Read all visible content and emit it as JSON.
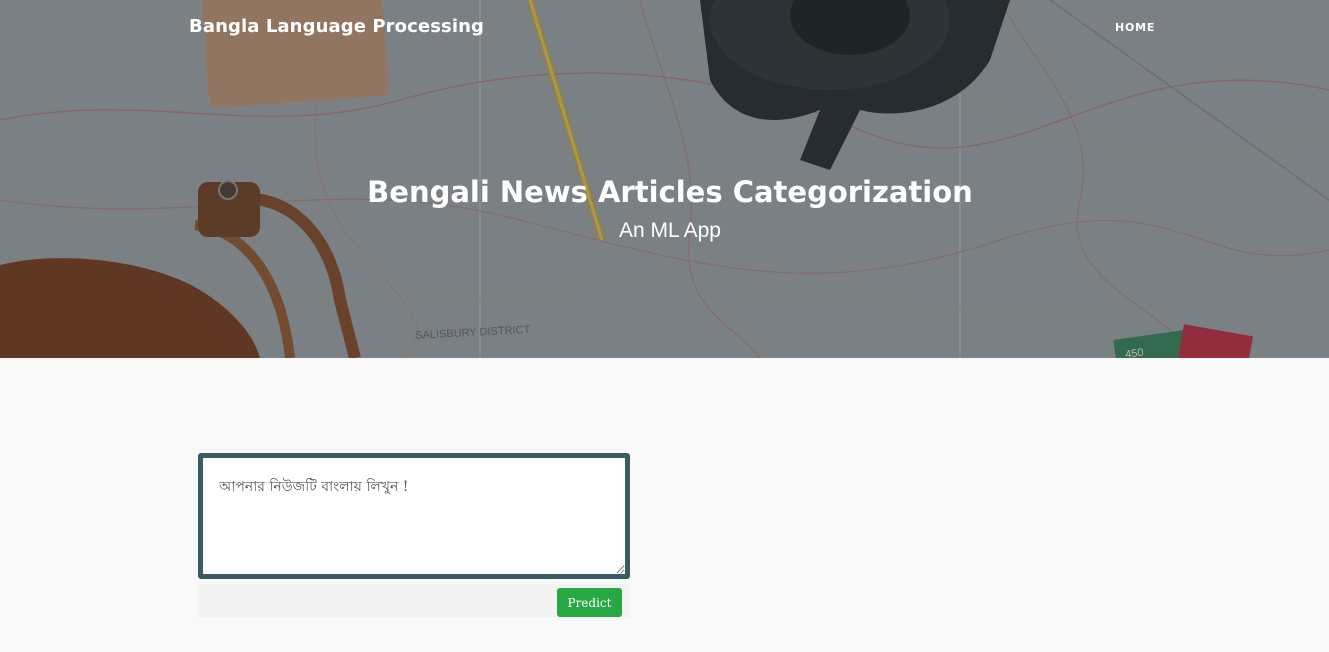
{
  "navbar": {
    "brand": "Bangla Language Processing",
    "links": [
      {
        "label": "HOME"
      }
    ]
  },
  "hero": {
    "title": "Bengali News Articles Categorization",
    "subtitle": "An ML App",
    "map_label": "SALISBURY DISTRICT",
    "map_number": "450"
  },
  "form": {
    "textarea": {
      "placeholder": "আপনার নিউজটি বাংলায় লিখুন !",
      "value": ""
    },
    "submit_label": "Predict"
  },
  "colors": {
    "textarea_border": "#395d62",
    "predict_button": "#28a745",
    "page_background": "#f9f9f9"
  }
}
